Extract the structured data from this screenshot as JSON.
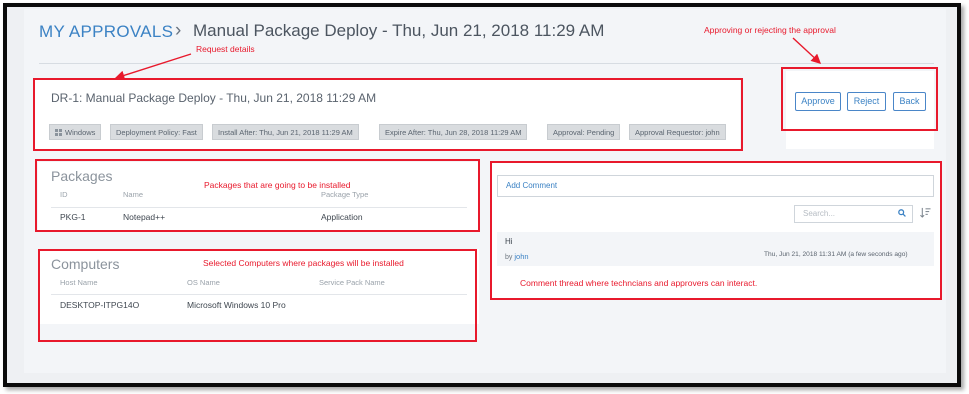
{
  "breadcrumb": {
    "root": "MY APPROVALS",
    "separator": "›",
    "current": "Manual Package Deploy - Thu, Jun 21, 2018 11:29 AM"
  },
  "request": {
    "title": "DR-1:  Manual Package Deploy - Thu, Jun 21, 2018 11:29 AM",
    "tags": {
      "os": "Windows",
      "policy": "Deployment Policy: Fast",
      "install_after": "Install After: Thu, Jun 21, 2018 11:29 AM",
      "expire_after": "Expire After: Thu, Jun 28, 2018 11:29 AM",
      "approval": "Approval: Pending",
      "requestor": "Approval Requestor: john"
    }
  },
  "actions": {
    "approve": "Approve",
    "reject": "Reject",
    "back": "Back"
  },
  "packages": {
    "title": "Packages",
    "columns": {
      "id": "ID",
      "name": "Name",
      "type": "Package Type"
    },
    "rows": [
      {
        "id": "PKG-1",
        "name": "Notepad++",
        "type": "Application"
      }
    ]
  },
  "computers": {
    "title": "Computers",
    "columns": {
      "host": "Host Name",
      "os": "OS Name",
      "sp": "Service Pack Name"
    },
    "rows": [
      {
        "host": "DESKTOP-ITPG14O",
        "os": "Microsoft Windows 10 Pro",
        "sp": ""
      }
    ]
  },
  "comments": {
    "add_label": "Add Comment",
    "search_placeholder": "Search...",
    "items": [
      {
        "text": "Hi",
        "by_prefix": "by",
        "user": "john",
        "time": "Thu, Jun 21, 2018 11:31 AM (a few seconds ago)"
      }
    ]
  },
  "annotations": {
    "request_details": "Request details",
    "approving": "Approving or rejecting the approval",
    "packages_note": "Packages that are going to be installed",
    "computers_note": "Selected Computers where packages will be installed",
    "comment_note": "Comment thread where techncians and approvers can interact."
  },
  "colors": {
    "accent": "#3b82c4",
    "annotation_red": "#e8192c",
    "tag_bg": "#d9dcdf"
  }
}
